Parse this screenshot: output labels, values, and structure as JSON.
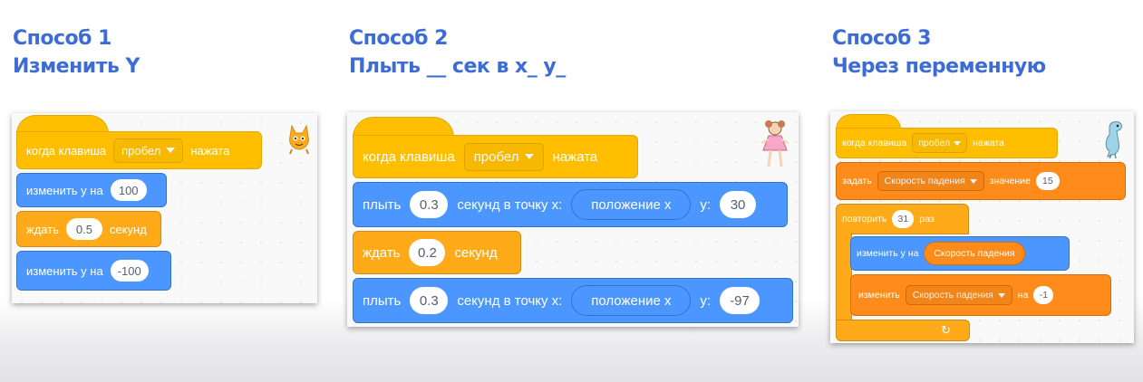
{
  "methods": [
    {
      "title_line1": "Способ 1",
      "title_line2": "Изменить Y",
      "blocks": {
        "when_key": {
          "when": "когда клавиша",
          "key": "пробел",
          "pressed": "нажата"
        },
        "change_y_1": {
          "label": "изменить у на",
          "value": "100"
        },
        "wait": {
          "label": "ждать",
          "value": "0.5",
          "unit": "секунд"
        },
        "change_y_2": {
          "label": "изменить у на",
          "value": "-100"
        }
      },
      "sprite": "scratch-cat-icon"
    },
    {
      "title_line1": "Способ 2",
      "title_line2": "Плыть __ сек в х_ у_",
      "blocks": {
        "when_key": {
          "when": "когда клавиша",
          "key": "пробел",
          "pressed": "нажата"
        },
        "glide_1": {
          "label": "плыть",
          "secs": "0.3",
          "to_label": "секунд в точку х:",
          "x_reporter": "положение х",
          "y_label": "у:",
          "y": "30"
        },
        "wait": {
          "label": "ждать",
          "value": "0.2",
          "unit": "секунд"
        },
        "glide_2": {
          "label": "плыть",
          "secs": "0.3",
          "to_label": "секунд в точку х:",
          "x_reporter": "положение х",
          "y_label": "у:",
          "y": "-97"
        }
      },
      "sprite": "ballerina-icon"
    },
    {
      "title_line1": "Способ 3",
      "title_line2": "Через переменную",
      "blocks": {
        "when_key": {
          "when": "когда клавиша",
          "key": "пробел",
          "pressed": "нажата"
        },
        "set_var": {
          "label": "задать",
          "variable": "Скорость падения",
          "value_label": "значение",
          "value": "15"
        },
        "repeat": {
          "label": "повторить",
          "times": "31",
          "unit": "раз"
        },
        "change_y": {
          "label": "изменить у на",
          "variable": "Скорость падения"
        },
        "change_var": {
          "label": "изменить",
          "variable": "Скорость падения",
          "by_label": "на",
          "value": "-1"
        },
        "loop_arrow": "↻"
      },
      "sprite": "dinosaur-icon"
    }
  ],
  "colors": {
    "title": "#3d6cd6",
    "events": "#ffbf00",
    "motion": "#4c97ff",
    "control": "#ffab19",
    "variables": "#ff8c1a"
  }
}
